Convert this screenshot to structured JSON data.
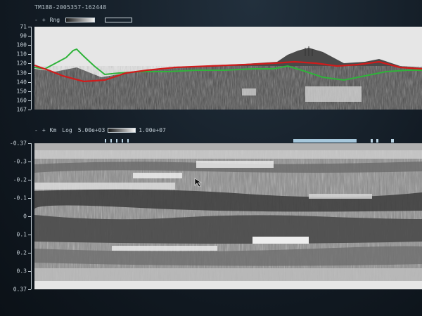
{
  "header": {
    "title": "TM188-2005357-162448"
  },
  "top_panel": {
    "controls": {
      "minus": "-",
      "plus": "+",
      "mode": "Rng"
    },
    "axis_labels": [
      "71",
      "90",
      "100",
      "110",
      "120",
      "130",
      "140",
      "150",
      "160",
      "167"
    ]
  },
  "bottom_panel": {
    "controls": {
      "minus": "-",
      "plus": "+",
      "unit": "Km",
      "scale": "Log",
      "min": "5.00e+03",
      "max": "1.00e+07"
    },
    "axis_labels": [
      "-0.37",
      "-0.3",
      "-0.2",
      "-0.1",
      "0",
      "0.1",
      "0.2",
      "0.3",
      "0.37"
    ]
  },
  "colors": {
    "red_trace": "#d01c1c",
    "green_trace": "#2fb33a",
    "background": "#131c25"
  },
  "icons": {
    "cursor": "cursor-icon"
  }
}
